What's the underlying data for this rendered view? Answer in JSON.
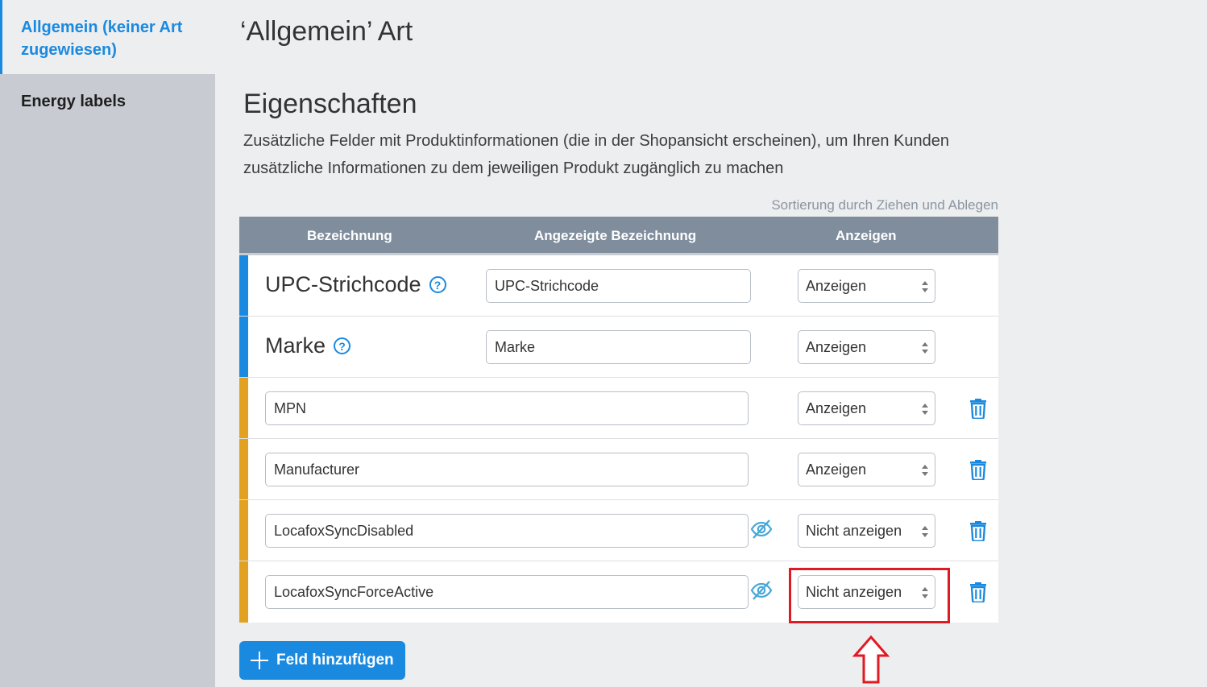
{
  "sidebar": {
    "items": [
      {
        "label_line1": "Allgemein (keiner Art",
        "label_line2": "zugewiesen)",
        "active": true
      },
      {
        "label": "Energy labels",
        "active": false
      }
    ]
  },
  "page": {
    "title": "‘Allgemein’ Art",
    "section_title": "Eigenschaften",
    "description": "Zusätzliche Felder mit Produktinformationen (die in der Shopansicht erscheinen), um Ihren Kunden zusätzliche Informationen zu dem jeweiligen Produkt zugänglich zu machen",
    "sort_hint": "Sortierung durch Ziehen und Ablegen"
  },
  "table": {
    "headers": [
      "Bezeichnung",
      "Angezeigte Bezeichnung",
      "Anzeigen"
    ],
    "rows": [
      {
        "type": "builtin",
        "label": "UPC-Strichcode",
        "display_label": "UPC-Strichcode",
        "visibility": "Anzeigen"
      },
      {
        "type": "builtin",
        "label": "Marke",
        "display_label": "Marke",
        "visibility": "Anzeigen"
      },
      {
        "type": "custom",
        "label": "MPN",
        "visibility": "Anzeigen"
      },
      {
        "type": "custom",
        "label": "Manufacturer",
        "visibility": "Anzeigen"
      },
      {
        "type": "custom",
        "label": "LocafoxSyncDisabled",
        "visibility": "Nicht anzeigen",
        "hidden": true
      },
      {
        "type": "custom",
        "label": "LocafoxSyncForceActive",
        "visibility": "Nicht anzeigen",
        "hidden": true
      }
    ]
  },
  "help_glyph": "?",
  "add_button": {
    "label": "Feld hinzufügen"
  },
  "colors": {
    "accent": "#1a8ae0",
    "builtin_bar": "#1a8ae0",
    "custom_bar": "#e3a121",
    "header_bg": "#7f8d9c",
    "highlight": "#e01a22"
  }
}
